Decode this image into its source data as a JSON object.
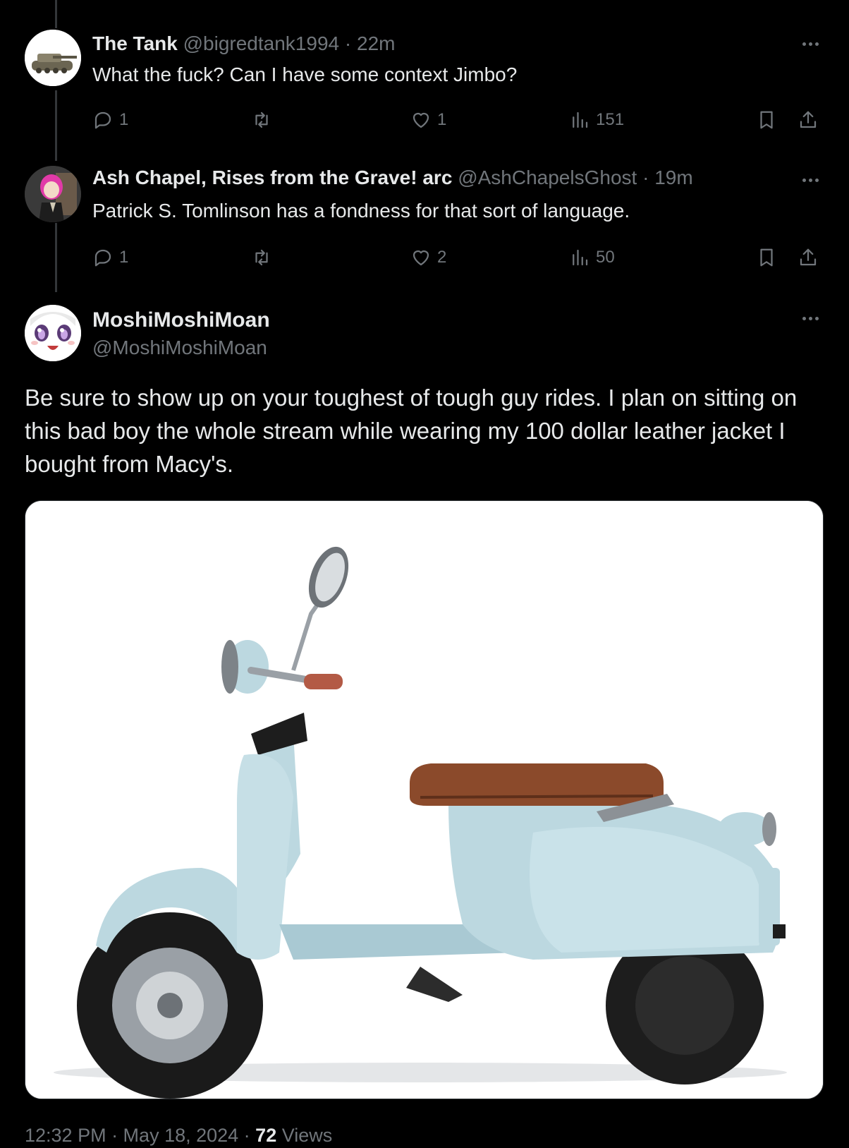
{
  "replies": [
    {
      "name": "The Tank",
      "handle": "@bigredtank1994",
      "separator": "·",
      "time": "22m",
      "text": "What the fuck?  Can I have some context Jimbo?",
      "replies_count": "1",
      "likes_count": "1",
      "views_count": "151",
      "avatar_icon": "tank-avatar"
    },
    {
      "name": "Ash Chapel, Rises from the Grave! arc",
      "handle": "@AshChapelsGhost",
      "separator": "·",
      "time": "19m",
      "text": "Patrick S. Tomlinson has a fondness for that sort of language.",
      "replies_count": "1",
      "likes_count": "2",
      "views_count": "50",
      "avatar_icon": "anime-character-avatar"
    }
  ],
  "main_post": {
    "name": "MoshiMoshiMoan",
    "handle": "@MoshiMoshiMoan",
    "text": "Be sure to show up on your toughest of tough guy rides.  I plan on sitting on this bad boy the whole stream while wearing my 100 dollar leather jacket I bought from Macy's.",
    "avatar_icon": "anime-face-avatar",
    "media_icon": "light-blue-scooter-image",
    "timestamp": "12:32 PM · May 18, 2024 · ",
    "views_count": "72",
    "views_label": " Views"
  },
  "colors": {
    "background": "#000000",
    "text": "#e7e9ea",
    "muted": "#71767b",
    "scooter_body": "#bcd8e0",
    "seat": "#8b4a2b"
  }
}
